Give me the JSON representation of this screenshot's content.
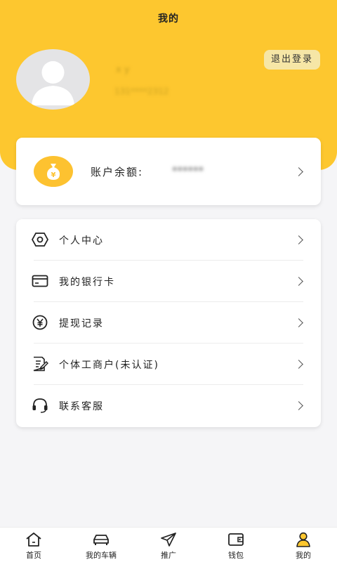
{
  "header": {
    "title": "我的",
    "logout_label": "退出登录",
    "accent_color": "#fdc72f"
  },
  "user": {
    "name": "x  y",
    "phone": "131****2312"
  },
  "balance": {
    "label": "账户余额:",
    "value": "******",
    "icon": "yen-bag-icon"
  },
  "menu": {
    "items": [
      {
        "label": "个人中心",
        "icon": "hexagon-settings-icon"
      },
      {
        "label": "我的银行卡",
        "icon": "bank-card-icon"
      },
      {
        "label": "提现记录",
        "icon": "yen-circle-icon"
      },
      {
        "label": "个体工商户(未认证)",
        "icon": "document-edit-icon"
      },
      {
        "label": "联系客服",
        "icon": "headset-icon"
      }
    ]
  },
  "tabbar": {
    "items": [
      {
        "label": "首页",
        "icon": "home-icon",
        "active": false
      },
      {
        "label": "我的车辆",
        "icon": "car-icon",
        "active": false
      },
      {
        "label": "推广",
        "icon": "paper-plane-icon",
        "active": false
      },
      {
        "label": "钱包",
        "icon": "wallet-icon",
        "active": false
      },
      {
        "label": "我的",
        "icon": "user-icon",
        "active": true
      }
    ]
  }
}
